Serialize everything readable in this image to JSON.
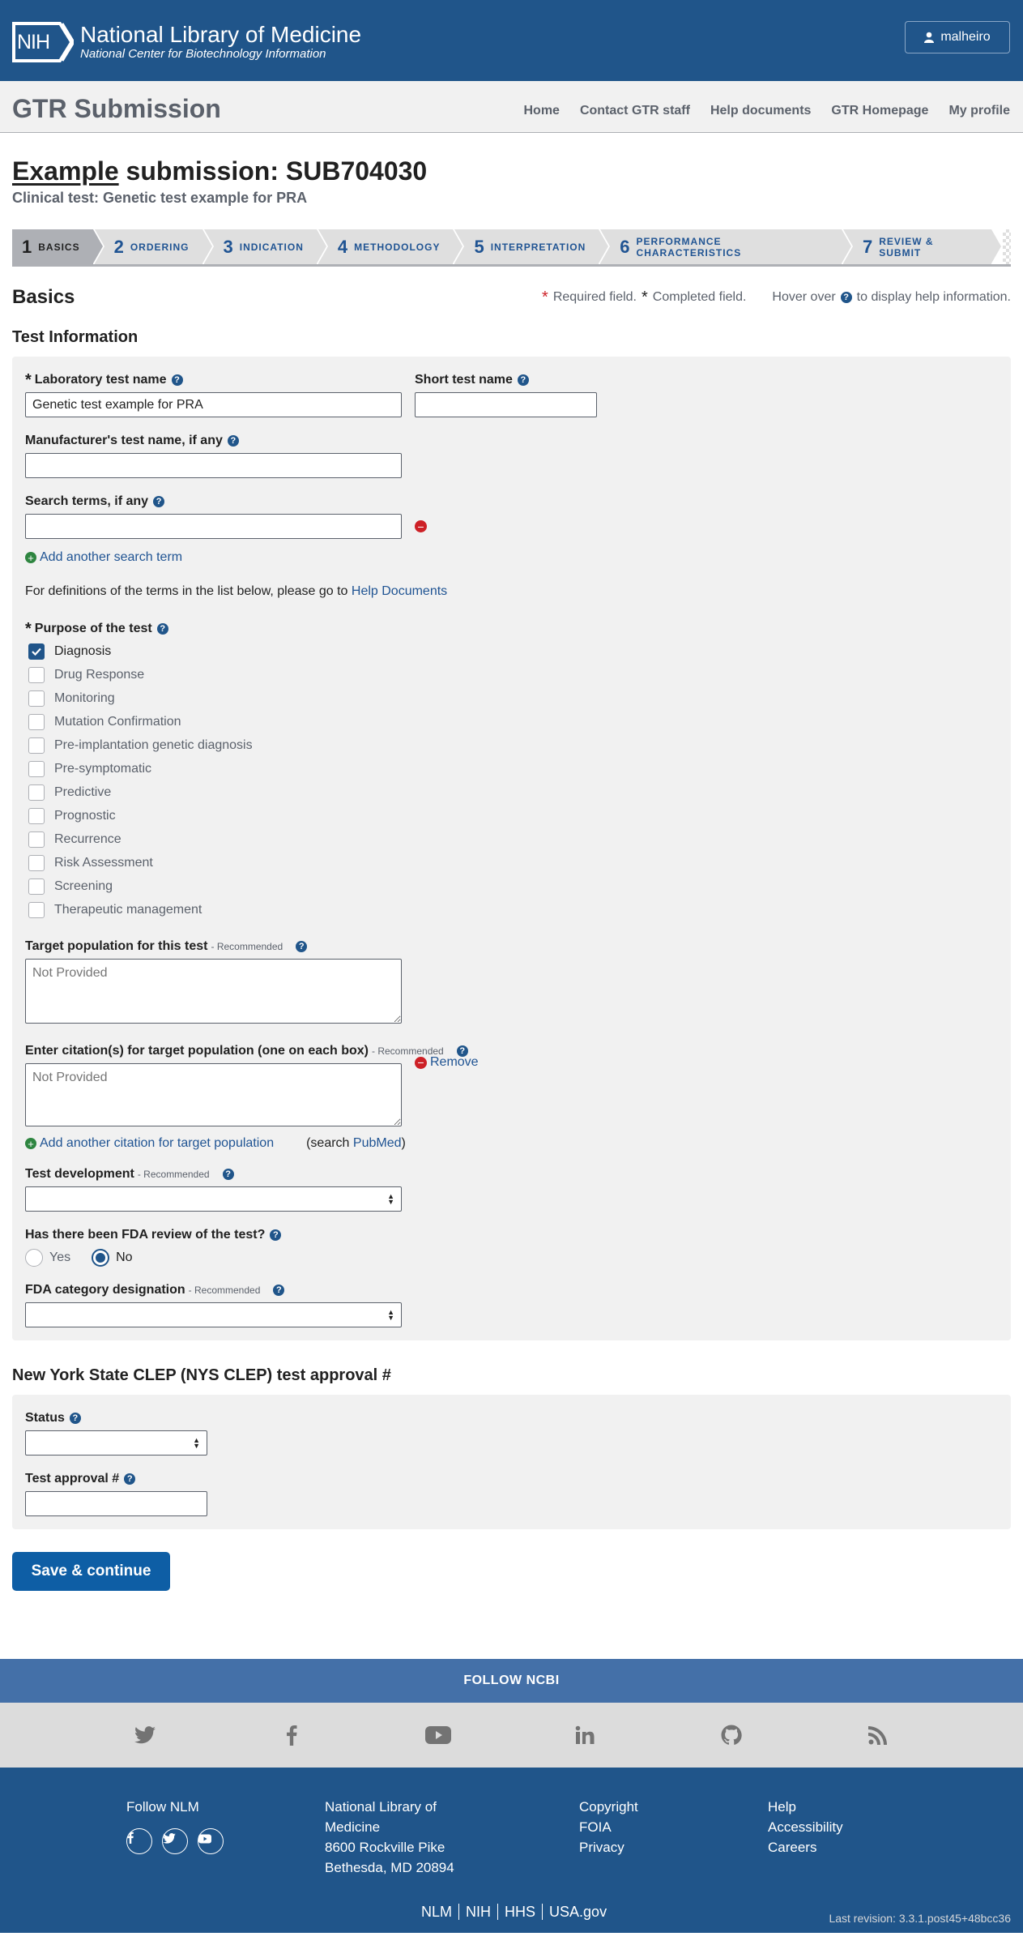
{
  "header": {
    "logo_text": "NIH",
    "org_title": "National Library of Medicine",
    "org_subtitle": "National Center for Biotechnology Information",
    "user_name": "malheiro",
    "colors": {
      "header_bg": "#20558a",
      "accent": "#0e5ea5",
      "required": "#cd2026",
      "add": "#2e8540"
    }
  },
  "app_nav": {
    "title": "GTR Submission",
    "links": [
      "Home",
      "Contact GTR staff",
      "Help documents",
      "GTR Homepage",
      "My profile"
    ]
  },
  "submission": {
    "title_underlined": "Example",
    "title_rest": " submission: SUB704030",
    "clinical_test": "Clinical test: Genetic test example for PRA"
  },
  "steps": [
    {
      "num": "1",
      "label": "BASICS"
    },
    {
      "num": "2",
      "label": "ORDERING"
    },
    {
      "num": "3",
      "label": "INDICATION"
    },
    {
      "num": "4",
      "label": "METHODOLOGY"
    },
    {
      "num": "5",
      "label": "INTERPRETATION"
    },
    {
      "num": "6",
      "label": "PERFORMANCE CHARACTERISTICS"
    },
    {
      "num": "7",
      "label": "REVIEW & SUBMIT"
    }
  ],
  "section": {
    "title": "Basics",
    "legend_required": "Required field.",
    "legend_completed": "Completed field.",
    "legend_hover_pre": "Hover over",
    "legend_hover_post": "to display help information."
  },
  "test_info": {
    "title": "Test Information",
    "lab_test_name_label": "Laboratory test name",
    "lab_test_name_value": "Genetic test example for PRA",
    "short_test_name_label": "Short test name",
    "short_test_name_value": "",
    "manufacturer_label": "Manufacturer's test name, if any",
    "search_terms_label": "Search terms, if any",
    "add_search_term": "Add another search term",
    "definitions_text": "For definitions of the terms in the list below, please go to",
    "definitions_link": "Help Documents",
    "purpose_label": "Purpose of the test",
    "purposes": [
      {
        "label": "Diagnosis",
        "checked": true
      },
      {
        "label": "Drug Response",
        "checked": false
      },
      {
        "label": "Monitoring",
        "checked": false
      },
      {
        "label": "Mutation Confirmation",
        "checked": false
      },
      {
        "label": "Pre-implantation genetic diagnosis",
        "checked": false
      },
      {
        "label": "Pre-symptomatic",
        "checked": false
      },
      {
        "label": "Predictive",
        "checked": false
      },
      {
        "label": "Prognostic",
        "checked": false
      },
      {
        "label": "Recurrence",
        "checked": false
      },
      {
        "label": "Risk Assessment",
        "checked": false
      },
      {
        "label": "Screening",
        "checked": false
      },
      {
        "label": "Therapeutic management",
        "checked": false
      }
    ],
    "target_pop_label": "Target population for this test",
    "recommended": "- Recommended",
    "target_pop_placeholder": "Not Provided",
    "citation_label": "Enter citation(s) for target population (one on each box)",
    "citation_placeholder": "Not Provided",
    "remove": "Remove",
    "add_citation": "Add another citation for target population",
    "search_pre": "(search ",
    "search_link": "PubMed",
    "search_post": ")",
    "test_dev_label": "Test development",
    "fda_review_label": "Has there been FDA review of the test?",
    "fda_yes": "Yes",
    "fda_no": "No",
    "fda_selected": "No",
    "fda_category_label": "FDA category designation"
  },
  "nys": {
    "title": "New York State CLEP (NYS CLEP) test approval #",
    "status_label": "Status",
    "approval_label": "Test approval #"
  },
  "save_button": "Save & continue",
  "footer": {
    "follow_ncbi": "FOLLOW NCBI",
    "social_icons": [
      "twitter-icon",
      "facebook-icon",
      "youtube-icon",
      "linkedin-icon",
      "github-icon",
      "rss-icon"
    ],
    "follow_nlm": "Follow NLM",
    "address": [
      "National Library of",
      "Medicine",
      "8600 Rockville Pike",
      "Bethesda, MD 20894"
    ],
    "col3": [
      "Copyright",
      "FOIA",
      "Privacy"
    ],
    "col4": [
      "Help",
      "Accessibility",
      "Careers"
    ],
    "bottom_links": [
      "NLM",
      "NIH",
      "HHS",
      "USA.gov"
    ],
    "revision": "Last revision: 3.3.1.post45+48bcc36"
  }
}
